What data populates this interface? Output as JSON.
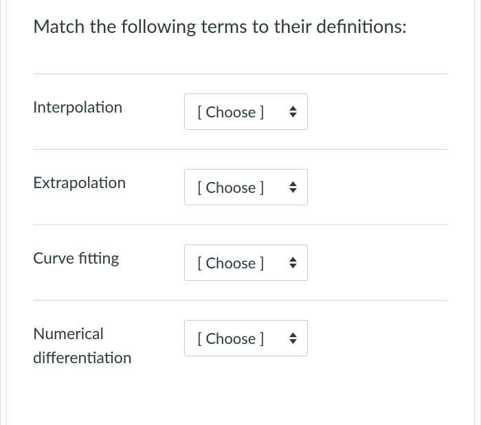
{
  "question": {
    "prompt": "Match the following terms to their definitions:"
  },
  "rows": [
    {
      "term": "Interpolation",
      "selected": "[ Choose ]"
    },
    {
      "term": "Extrapolation",
      "selected": "[ Choose ]"
    },
    {
      "term": "Curve fitting",
      "selected": "[ Choose ]"
    },
    {
      "term": "Numerical differentiation",
      "selected": "[ Choose ]"
    }
  ]
}
